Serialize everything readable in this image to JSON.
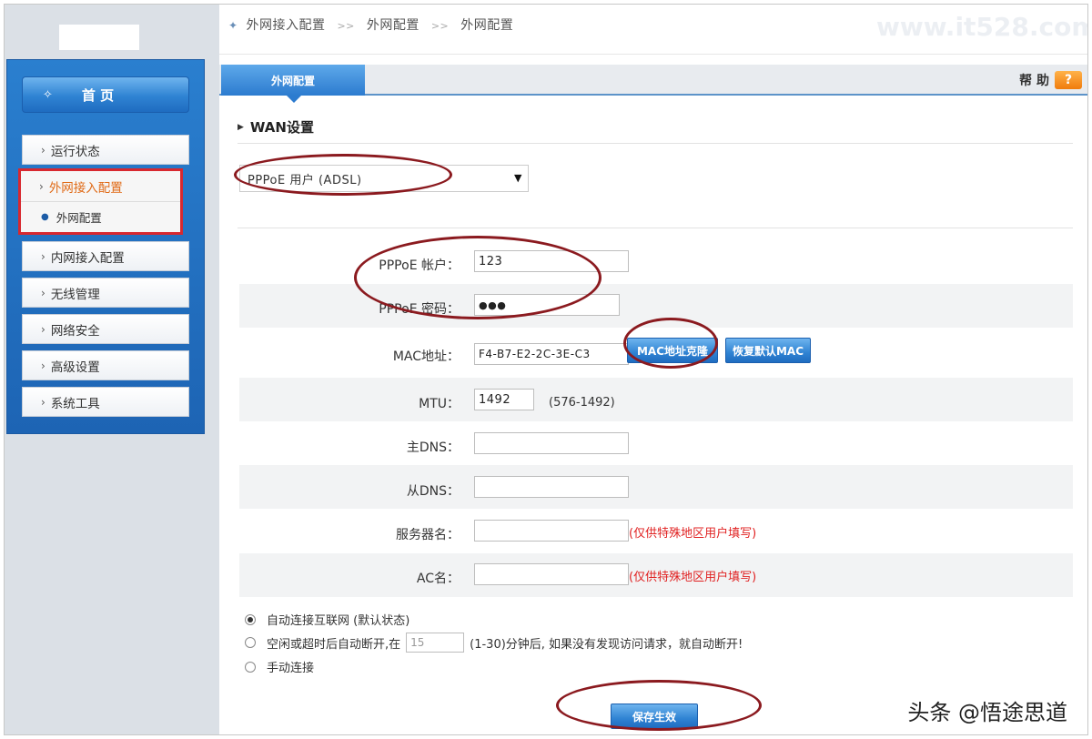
{
  "breadcrumb": {
    "items": [
      "外网接入配置",
      "外网配置",
      "外网配置"
    ],
    "sep": ">>"
  },
  "watermark": "www.it528.com",
  "sidebar": {
    "home_label": "首 页",
    "items": [
      {
        "label": "运行状态"
      },
      {
        "label": "外网接入配置"
      },
      {
        "label": "外网配置"
      },
      {
        "label": "内网接入配置"
      },
      {
        "label": "无线管理"
      },
      {
        "label": "网络安全"
      },
      {
        "label": "高级设置"
      },
      {
        "label": "系统工具"
      }
    ]
  },
  "tab": {
    "label": "外网配置"
  },
  "help": {
    "label": "帮 助",
    "icon_text": "?"
  },
  "section": {
    "title": "WAN设置"
  },
  "connection_type": {
    "value": "PPPoE 用户 (ADSL)"
  },
  "form": {
    "pppoe_account": {
      "label": "PPPoE 帐户：",
      "value": "123"
    },
    "pppoe_password": {
      "label": "PPPoE 密码：",
      "value": "●●●"
    },
    "mac": {
      "label": "MAC地址：",
      "value": "F4-B7-E2-2C-3E-C3",
      "clone_btn": "MAC地址克隆",
      "restore_btn": "恢复默认MAC"
    },
    "mtu": {
      "label": "MTU：",
      "value": "1492",
      "range": "(576-1492)"
    },
    "dns1": {
      "label": "主DNS：",
      "value": ""
    },
    "dns2": {
      "label": "从DNS：",
      "value": ""
    },
    "server_name": {
      "label": "服务器名：",
      "value": "",
      "hint": "(仅供特殊地区用户填写)"
    },
    "ac_name": {
      "label": "AC名：",
      "value": "",
      "hint": "(仅供特殊地区用户填写)"
    }
  },
  "connect_mode": {
    "auto": "自动连接互联网 (默认状态)",
    "idle_prefix": "空闲或超时后自动断开,在",
    "idle_value": "15",
    "idle_suffix": "(1-30)分钟后, 如果没有发现访问请求，就自动断开!",
    "manual": "手动连接",
    "selected": "auto"
  },
  "save_label": "保存生效",
  "signature": "头条 @悟途思道",
  "colors": {
    "accent": "#2c7bcf",
    "highlight_box": "#d8282f",
    "annotation_ring": "#8b1a1f",
    "hint": "#e02020"
  }
}
